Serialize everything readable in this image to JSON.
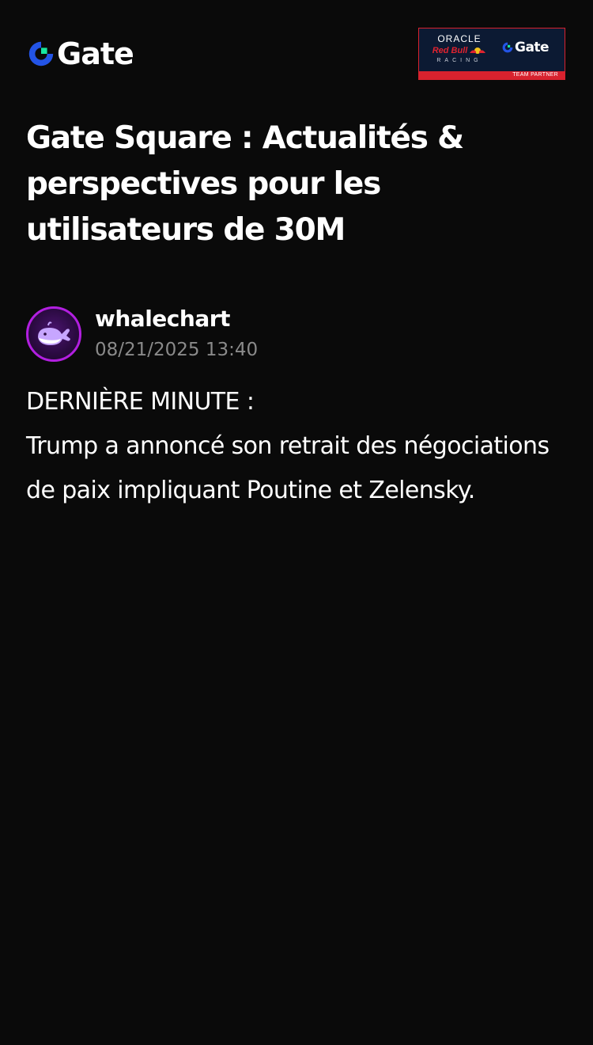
{
  "header": {
    "logo_text": "Gate",
    "logo_icon": "gate-logo-icon",
    "partner": {
      "oracle": "ORACLE",
      "redbull": "Red Bull",
      "racing": "RACING",
      "gate_text": "Gate",
      "badge": "TEAM PARTNER"
    }
  },
  "page": {
    "title": "Gate Square : Actualités & perspectives pour les utilisateurs de 30M"
  },
  "post": {
    "author": "whalechart",
    "avatar_icon": "whale-icon",
    "timestamp": "08/21/2025 13:40",
    "body": [
      "DERNIÈRE MINUTE :",
      "Trump a annoncé son retrait des négociations de paix impliquant Poutine et Zelensky."
    ]
  },
  "colors": {
    "background": "#0a0a0a",
    "brand_blue": "#2354e6",
    "brand_green": "#17e6a1",
    "text_primary": "#ffffff",
    "text_secondary": "#8a8a8a",
    "avatar_ring": "#b21fe0",
    "partner_red": "#d8222e",
    "partner_navy": "#0c1a33"
  }
}
